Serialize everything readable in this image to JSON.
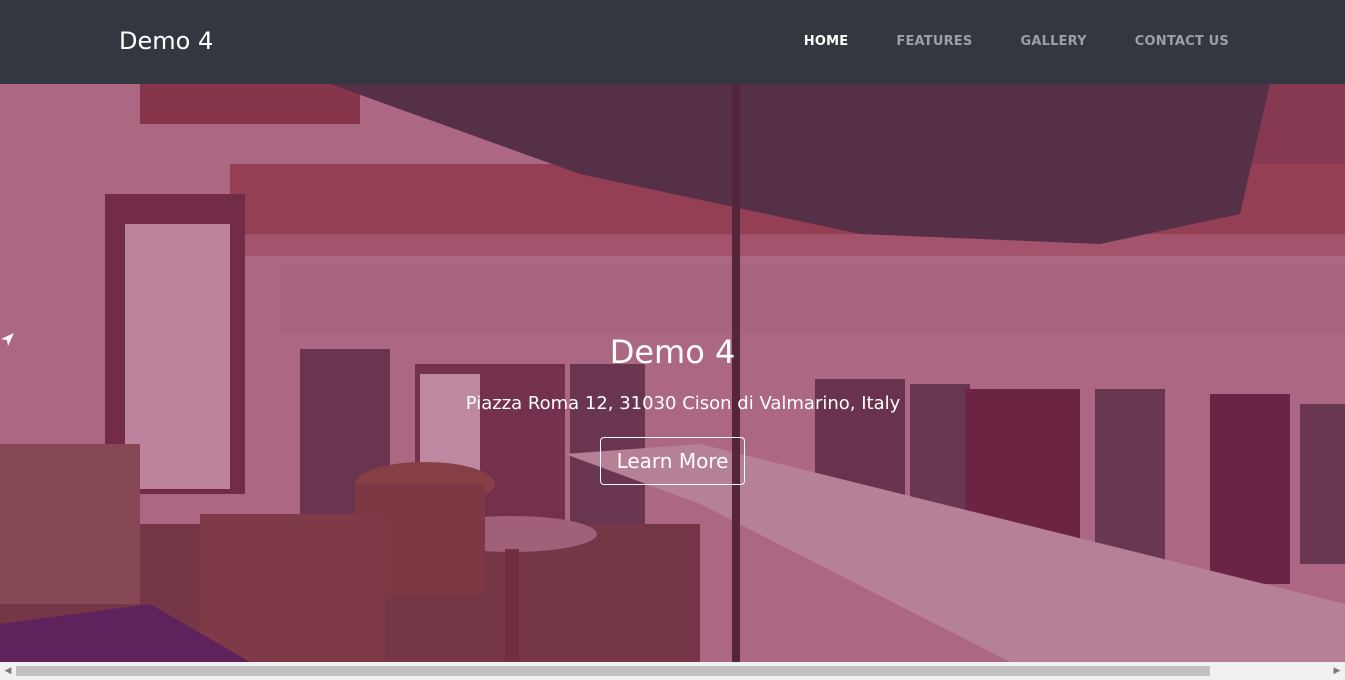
{
  "brand": "Demo 4",
  "nav": [
    {
      "label": "HOME",
      "active": true
    },
    {
      "label": "FEATURES",
      "active": false
    },
    {
      "label": "GALLERY",
      "active": false
    },
    {
      "label": "CONTACT US",
      "active": false
    }
  ],
  "hero": {
    "title": "Demo 4",
    "address": "Piazza Roma 12, 31030 Cison di Valmarino, Italy",
    "button": "Learn More",
    "overlay_color": "#801448",
    "icons": [
      "location-arrow-icon"
    ]
  },
  "scrollbar": {
    "left_arrow": "◀",
    "right_arrow": "▶"
  }
}
